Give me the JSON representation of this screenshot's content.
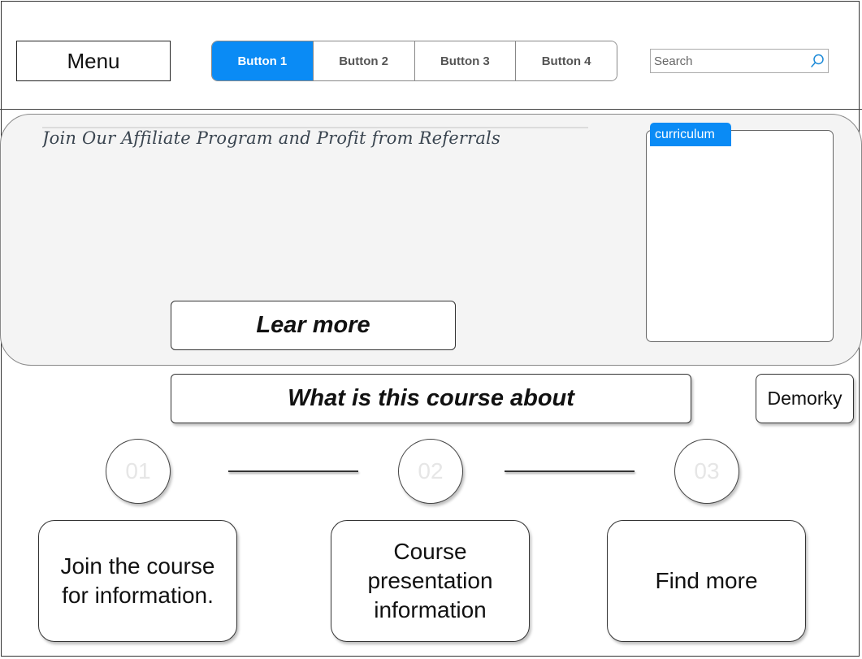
{
  "header": {
    "menu_label": "Menu",
    "buttons": [
      {
        "label": "Button 1",
        "active": true
      },
      {
        "label": "Button 2",
        "active": false
      },
      {
        "label": "Button 3",
        "active": false
      },
      {
        "label": "Button 4",
        "active": false
      }
    ],
    "search": {
      "placeholder": "Search",
      "value": "",
      "icon": "search-icon"
    }
  },
  "hero": {
    "title": "Join Our Affiliate Program and Profit from Referrals",
    "cta_label": "Lear more",
    "curriculum_tab": "curriculum"
  },
  "about": {
    "heading": "What is this course about",
    "side_button": "Demorky"
  },
  "steps": [
    {
      "number": "01",
      "text": "Join the course for information."
    },
    {
      "number": "02",
      "text": "Course presentation information"
    },
    {
      "number": "03",
      "text": "Find more"
    }
  ],
  "colors": {
    "accent": "#0a8bf5",
    "hero_bg": "#f4f4f4",
    "step_number": "#e6e6e6"
  }
}
